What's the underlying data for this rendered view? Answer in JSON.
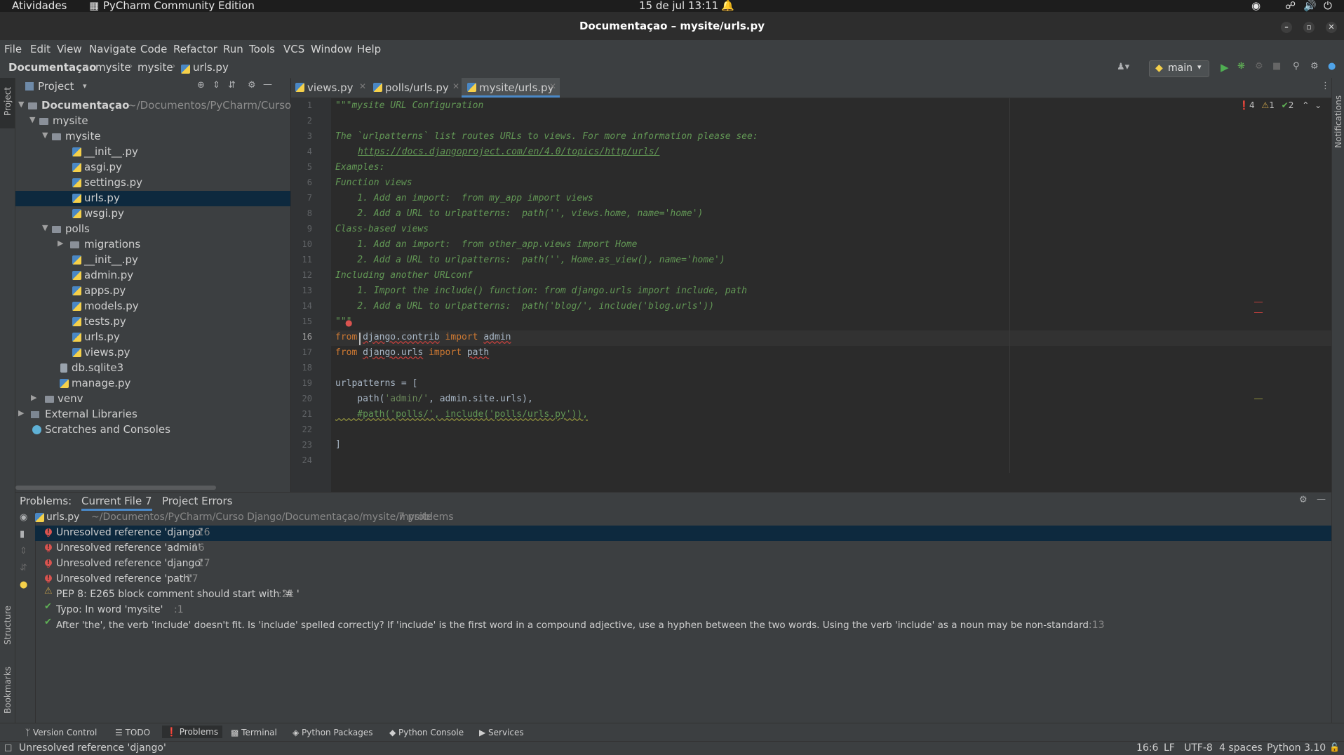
{
  "gnome_bar": {
    "activities": "Atividades",
    "app": "PyCharm Community Edition",
    "datetime": "15 de jul  13:11"
  },
  "window": {
    "title": "Documentaçao – mysite/urls.py"
  },
  "menu": [
    "File",
    "Edit",
    "View",
    "Navigate",
    "Code",
    "Refactor",
    "Run",
    "Tools",
    "VCS",
    "Window",
    "Help"
  ],
  "breadcrumbs": [
    "Documentaçao",
    "mysite",
    "mysite",
    "urls.py"
  ],
  "run_config": "main",
  "project_panel": {
    "title": "Project",
    "tree": [
      {
        "label": "Documentaçao",
        "path": "~/Documentos/PyCharm/Curso Dj",
        "type": "folder"
      },
      {
        "label": "mysite",
        "type": "folder"
      },
      {
        "label": "mysite",
        "type": "folder"
      },
      {
        "label": "__init__.py",
        "type": "py"
      },
      {
        "label": "asgi.py",
        "type": "py"
      },
      {
        "label": "settings.py",
        "type": "py"
      },
      {
        "label": "urls.py",
        "type": "py",
        "selected": true
      },
      {
        "label": "wsgi.py",
        "type": "py"
      },
      {
        "label": "polls",
        "type": "folder"
      },
      {
        "label": "migrations",
        "type": "folder"
      },
      {
        "label": "__init__.py",
        "type": "py"
      },
      {
        "label": "admin.py",
        "type": "py"
      },
      {
        "label": "apps.py",
        "type": "py"
      },
      {
        "label": "models.py",
        "type": "py"
      },
      {
        "label": "tests.py",
        "type": "py"
      },
      {
        "label": "urls.py",
        "type": "py"
      },
      {
        "label": "views.py",
        "type": "py"
      },
      {
        "label": "db.sqlite3",
        "type": "db"
      },
      {
        "label": "manage.py",
        "type": "py"
      },
      {
        "label": "venv",
        "type": "folder"
      },
      {
        "label": "External Libraries",
        "type": "lib"
      },
      {
        "label": "Scratches and Consoles",
        "type": "scratch"
      }
    ]
  },
  "editor_tabs": [
    "views.py",
    "polls/urls.py",
    "mysite/urls.py"
  ],
  "inspection": {
    "errors": "4",
    "warnings": "1",
    "typos": "2"
  },
  "line_numbers": [
    "1",
    "2",
    "3",
    "4",
    "5",
    "6",
    "7",
    "8",
    "9",
    "10",
    "11",
    "12",
    "13",
    "14",
    "15",
    "16",
    "17",
    "18",
    "19",
    "20",
    "21",
    "22",
    "23",
    "24"
  ],
  "code": {
    "l1": "\"\"\"mysite URL Configuration",
    "l3": "The `urlpatterns` list routes URLs to views. For more information please see:",
    "l4": "https://docs.djangoproject.com/en/4.0/topics/http/urls/",
    "l5": "Examples:",
    "l6": "Function views",
    "l7": "    1. Add an import:  from my_app import views",
    "l8": "    2. Add a URL to urlpatterns:  path('', views.home, name='home')",
    "l9": "Class-based views",
    "l10": "    1. Add an import:  from other_app.views import Home",
    "l11": "    2. Add a URL to urlpatterns:  path('', Home.as_view(), name='home')",
    "l12": "Including another URLconf",
    "l13": "    1. Import the include() function: from django.urls import include, path",
    "l14": "    2. Add a URL to urlpatterns:  path('blog/', include('blog.urls'))",
    "l15": "\"\"\"",
    "l16_kw": "from",
    "l16_mod": "django.contrib",
    "l16_imp": "import",
    "l16_name": "admin",
    "l17_kw": "from",
    "l17_mod": "django.urls",
    "l17_imp": "import",
    "l17_name": "path",
    "l19": "urlpatterns = [",
    "l20_a": "    path(",
    "l20_str": "'admin/'",
    "l20_b": ", admin.site.urls),",
    "l21": "    #path('polls/', include('polls/urls.py')),",
    "l23": "]"
  },
  "problems": {
    "label": "Problems:",
    "tabs": [
      "Current File 7",
      "Project Errors"
    ],
    "file": "urls.py",
    "file_path": "~/Documentos/PyCharm/Curso Django/Documentaçao/mysite/mysite",
    "count": "7 problems",
    "items": [
      {
        "severity": "error",
        "text": "Unresolved reference 'django'",
        "line": ":16"
      },
      {
        "severity": "error",
        "text": "Unresolved reference 'admin'",
        "line": ":16"
      },
      {
        "severity": "error",
        "text": "Unresolved reference 'django'",
        "line": ":17"
      },
      {
        "severity": "error",
        "text": "Unresolved reference 'path'",
        "line": ":17"
      },
      {
        "severity": "warning",
        "text": "PEP 8: E265 block comment should start with '# '",
        "line": ":21"
      },
      {
        "severity": "typo",
        "text": "Typo: In word 'mysite'",
        "line": ":1"
      },
      {
        "severity": "typo",
        "text": "After 'the', the verb 'include' doesn't fit. Is 'include' spelled correctly? If 'include' is the first word in a compound adjective, use a hyphen between the two words. Using the verb 'include' as a noun may be non-standard.",
        "line": ":13"
      }
    ]
  },
  "tool_windows": [
    "Version Control",
    "TODO",
    "Problems",
    "Terminal",
    "Python Packages",
    "Python Console",
    "Services"
  ],
  "side_tabs": {
    "project": "Project",
    "structure": "Structure",
    "bookmarks": "Bookmarks",
    "notifications": "Notifications"
  },
  "status": {
    "message": "Unresolved reference 'django'",
    "position": "16:6",
    "line_sep": "LF",
    "encoding": "UTF-8",
    "indent": "4 spaces",
    "interpreter": "Python 3.10"
  }
}
